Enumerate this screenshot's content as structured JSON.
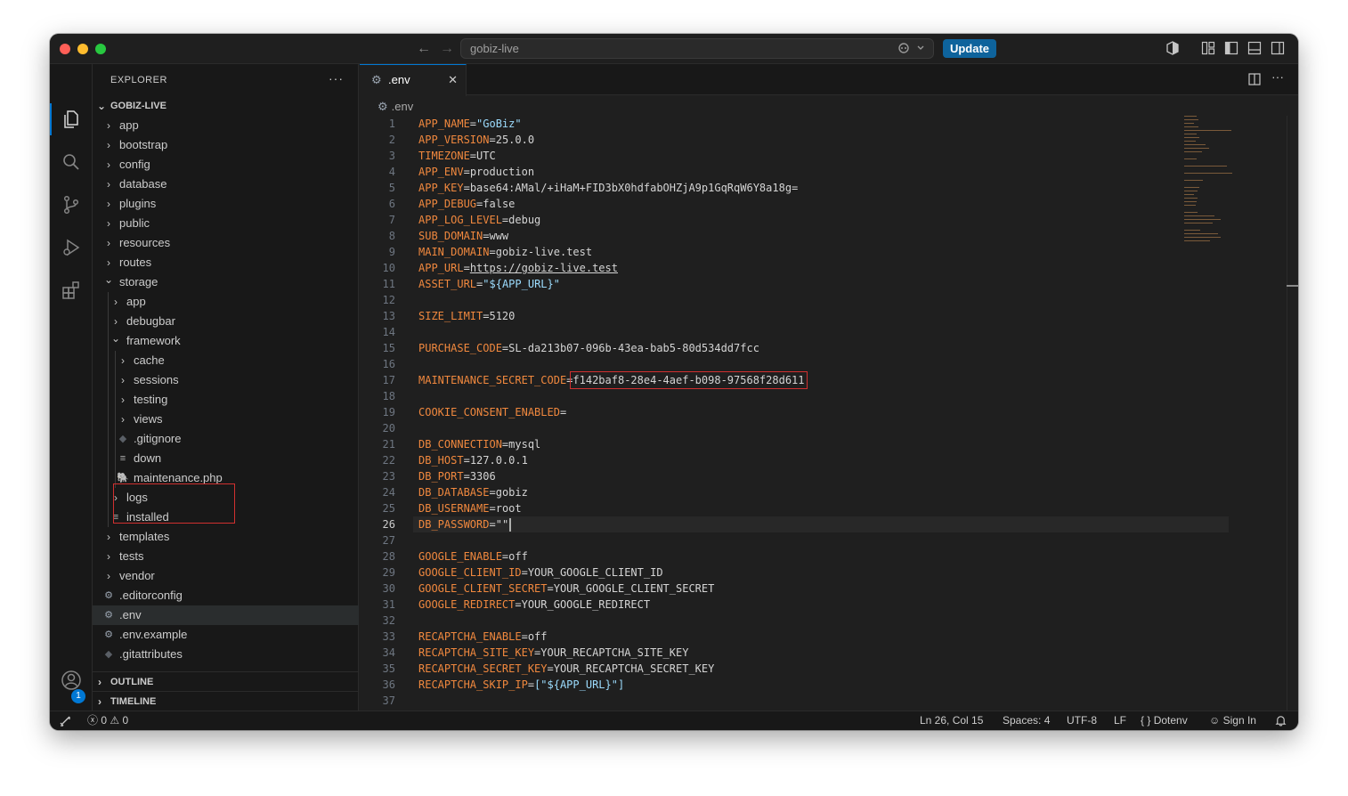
{
  "titlebar": {
    "search_text": "gobiz-live",
    "update_label": "Update"
  },
  "explorer": {
    "title": "EXPLORER",
    "root": "GOBIZ-LIVE",
    "items": [
      {
        "label": "app",
        "kind": "folder",
        "depth": 0,
        "expanded": false
      },
      {
        "label": "bootstrap",
        "kind": "folder",
        "depth": 0,
        "expanded": false
      },
      {
        "label": "config",
        "kind": "folder",
        "depth": 0,
        "expanded": false
      },
      {
        "label": "database",
        "kind": "folder",
        "depth": 0,
        "expanded": false
      },
      {
        "label": "plugins",
        "kind": "folder",
        "depth": 0,
        "expanded": false
      },
      {
        "label": "public",
        "kind": "folder",
        "depth": 0,
        "expanded": false
      },
      {
        "label": "resources",
        "kind": "folder",
        "depth": 0,
        "expanded": false
      },
      {
        "label": "routes",
        "kind": "folder",
        "depth": 0,
        "expanded": false
      },
      {
        "label": "storage",
        "kind": "folder",
        "depth": 0,
        "expanded": true
      },
      {
        "label": "app",
        "kind": "folder",
        "depth": 1,
        "expanded": false
      },
      {
        "label": "debugbar",
        "kind": "folder",
        "depth": 1,
        "expanded": false
      },
      {
        "label": "framework",
        "kind": "folder",
        "depth": 1,
        "expanded": true
      },
      {
        "label": "cache",
        "kind": "folder",
        "depth": 2,
        "expanded": false
      },
      {
        "label": "sessions",
        "kind": "folder",
        "depth": 2,
        "expanded": false
      },
      {
        "label": "testing",
        "kind": "folder",
        "depth": 2,
        "expanded": false
      },
      {
        "label": "views",
        "kind": "folder",
        "depth": 2,
        "expanded": false
      },
      {
        "label": ".gitignore",
        "kind": "git",
        "depth": 2
      },
      {
        "label": "down",
        "kind": "text",
        "depth": 2
      },
      {
        "label": "maintenance.php",
        "kind": "php",
        "depth": 2
      },
      {
        "label": "logs",
        "kind": "folder",
        "depth": 1,
        "expanded": false
      },
      {
        "label": "installed",
        "kind": "text",
        "depth": 1
      },
      {
        "label": "templates",
        "kind": "folder",
        "depth": 0,
        "expanded": false
      },
      {
        "label": "tests",
        "kind": "folder",
        "depth": 0,
        "expanded": false
      },
      {
        "label": "vendor",
        "kind": "folder",
        "depth": 0,
        "expanded": false
      },
      {
        "label": ".editorconfig",
        "kind": "gear",
        "depth": 0
      },
      {
        "label": ".env",
        "kind": "gear",
        "depth": 0,
        "selected": true
      },
      {
        "label": ".env.example",
        "kind": "gear",
        "depth": 0
      },
      {
        "label": ".gitattributes",
        "kind": "git",
        "depth": 0
      }
    ],
    "outline_label": "OUTLINE",
    "timeline_label": "TIMELINE"
  },
  "editor": {
    "tab_name": ".env",
    "breadcrumb": ".env",
    "active_line": 26,
    "lines": [
      {
        "n": 1,
        "key": "APP_NAME",
        "value": "\"GoBiz\"",
        "style": "str"
      },
      {
        "n": 2,
        "key": "APP_VERSION",
        "value": "25.0.0"
      },
      {
        "n": 3,
        "key": "TIMEZONE",
        "value": "UTC"
      },
      {
        "n": 4,
        "key": "APP_ENV",
        "value": "production"
      },
      {
        "n": 5,
        "key": "APP_KEY",
        "value": "base64:AMal/+iHaM+FID3bX0hdfabOHZjA9p1GqRqW6Y8a18g="
      },
      {
        "n": 6,
        "key": "APP_DEBUG",
        "value": "false"
      },
      {
        "n": 7,
        "key": "APP_LOG_LEVEL",
        "value": "debug"
      },
      {
        "n": 8,
        "key": "SUB_DOMAIN",
        "value": "www"
      },
      {
        "n": 9,
        "key": "MAIN_DOMAIN",
        "value": "gobiz-live.test"
      },
      {
        "n": 10,
        "key": "APP_URL",
        "value": "https://gobiz-live.test",
        "style": "url"
      },
      {
        "n": 11,
        "key": "ASSET_URL",
        "value": "\"${APP_URL}\"",
        "style": "interp"
      },
      {
        "n": 12,
        "key": "",
        "value": ""
      },
      {
        "n": 13,
        "key": "SIZE_LIMIT",
        "value": "5120"
      },
      {
        "n": 14,
        "key": "",
        "value": ""
      },
      {
        "n": 15,
        "key": "PURCHASE_CODE",
        "value": "SL-da213b07-096b-43ea-bab5-80d534dd7fcc"
      },
      {
        "n": 16,
        "key": "",
        "value": ""
      },
      {
        "n": 17,
        "key": "MAINTENANCE_SECRET_CODE",
        "value": "f142baf8-28e4-4aef-b098-97568f28d611",
        "style": "boxed"
      },
      {
        "n": 18,
        "key": "",
        "value": ""
      },
      {
        "n": 19,
        "key": "COOKIE_CONSENT_ENABLED",
        "value": ""
      },
      {
        "n": 20,
        "key": "",
        "value": ""
      },
      {
        "n": 21,
        "key": "DB_CONNECTION",
        "value": "mysql"
      },
      {
        "n": 22,
        "key": "DB_HOST",
        "value": "127.0.0.1"
      },
      {
        "n": 23,
        "key": "DB_PORT",
        "value": "3306"
      },
      {
        "n": 24,
        "key": "DB_DATABASE",
        "value": "gobiz"
      },
      {
        "n": 25,
        "key": "DB_USERNAME",
        "value": "root"
      },
      {
        "n": 26,
        "key": "DB_PASSWORD",
        "value": "\"\"",
        "style": "caret"
      },
      {
        "n": 27,
        "key": "",
        "value": ""
      },
      {
        "n": 28,
        "key": "GOOGLE_ENABLE",
        "value": "off"
      },
      {
        "n": 29,
        "key": "GOOGLE_CLIENT_ID",
        "value": "YOUR_GOOGLE_CLIENT_ID"
      },
      {
        "n": 30,
        "key": "GOOGLE_CLIENT_SECRET",
        "value": "YOUR_GOOGLE_CLIENT_SECRET"
      },
      {
        "n": 31,
        "key": "GOOGLE_REDIRECT",
        "value": "YOUR_GOOGLE_REDIRECT"
      },
      {
        "n": 32,
        "key": "",
        "value": ""
      },
      {
        "n": 33,
        "key": "RECAPTCHA_ENABLE",
        "value": "off"
      },
      {
        "n": 34,
        "key": "RECAPTCHA_SITE_KEY",
        "value": "YOUR_RECAPTCHA_SITE_KEY"
      },
      {
        "n": 35,
        "key": "RECAPTCHA_SECRET_KEY",
        "value": "YOUR_RECAPTCHA_SECRET_KEY"
      },
      {
        "n": 36,
        "key": "RECAPTCHA_SKIP_IP",
        "value": "[\"${APP_URL}\"]",
        "style": "interp"
      },
      {
        "n": 37,
        "key": "",
        "value": ""
      }
    ]
  },
  "statusbar": {
    "errors": "0",
    "warnings": "0",
    "position": "Ln 26, Col 15",
    "spaces": "Spaces: 4",
    "encoding": "UTF-8",
    "eol": "LF",
    "language": "Dotenv",
    "sign_in": "Sign In"
  },
  "activity": {
    "settings_badge": "1"
  },
  "colors": {
    "key": "#f0883e",
    "accent": "#0078d4",
    "highlight_box": "#d0302f",
    "update_button": "#0e639c"
  }
}
